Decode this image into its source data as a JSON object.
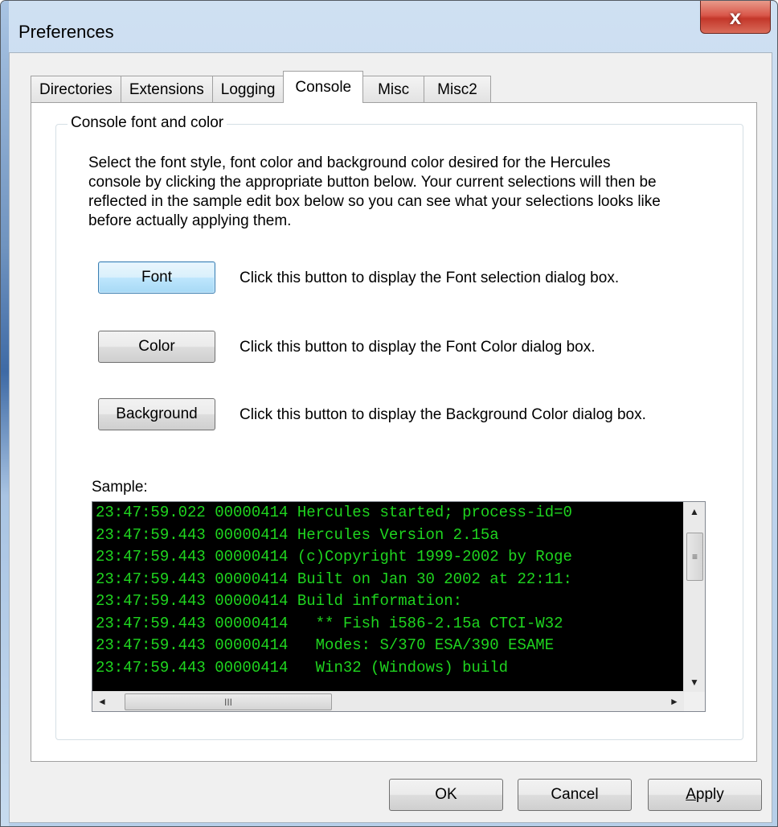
{
  "window": {
    "title": "Preferences",
    "close_glyph": "x"
  },
  "tabs": [
    {
      "label": "Directories",
      "active": false
    },
    {
      "label": "Extensions",
      "active": false
    },
    {
      "label": "Logging",
      "active": false
    },
    {
      "label": "Console",
      "active": true
    },
    {
      "label": "Misc",
      "active": false
    },
    {
      "label": "Misc2",
      "active": false
    }
  ],
  "group": {
    "label": "Console font and color",
    "description": "Select the font style, font color and background color desired for the Hercules console by clicking the appropriate button below. Your current selections will then be reflected in the sample edit box below so you can see what your selections looks like before actually applying them."
  },
  "actions": [
    {
      "label": "Font",
      "hint": "Click this button to display the Font selection dialog box."
    },
    {
      "label": "Color",
      "hint": "Click this button to display the Font Color dialog box."
    },
    {
      "label": "Background",
      "hint": "Click this button to display the Background Color dialog box."
    }
  ],
  "sample": {
    "label": "Sample:",
    "lines": [
      "23:47:59.022 00000414 Hercules started; process-id=0",
      "23:47:59.443 00000414 Hercules Version 2.15a",
      "23:47:59.443 00000414 (c)Copyright 1999-2002 by Roge",
      "23:47:59.443 00000414 Built on Jan 30 2002 at 22:11:",
      "23:47:59.443 00000414 Build information:",
      "23:47:59.443 00000414   ** Fish i586-2.15a CTCI-W32",
      "23:47:59.443 00000414   Modes: S/370 ESA/390 ESAME",
      "23:47:59.443 00000414   Win32 (Windows) build"
    ],
    "text_color": "#1fd51f",
    "background_color": "#000000",
    "scroll_glyphs": {
      "up": "▲",
      "down": "▼",
      "left": "◄",
      "right": "►",
      "grip_v": "≡",
      "grip_h": "III"
    }
  },
  "footer": {
    "ok_label": "OK",
    "cancel_label": "Cancel",
    "apply_label": "Apply"
  }
}
